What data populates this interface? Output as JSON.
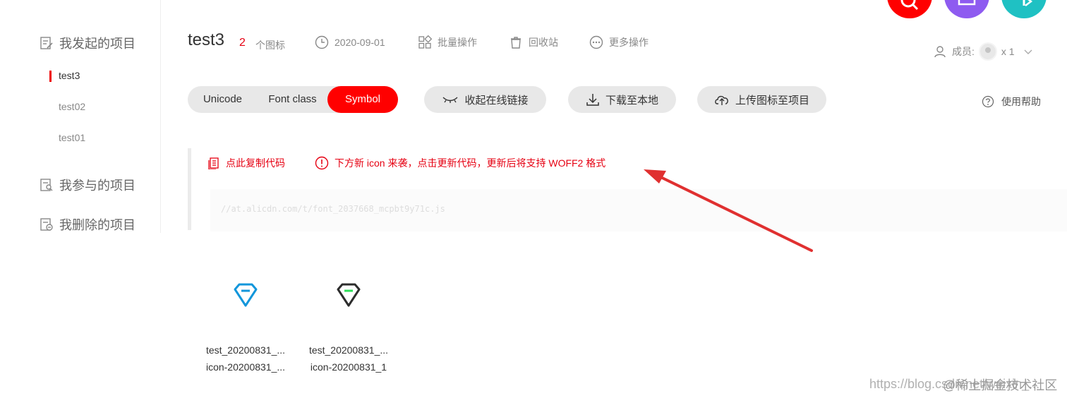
{
  "sidebar": {
    "group_mine": "我发起的项目",
    "items": [
      {
        "label": "test3",
        "active": true
      },
      {
        "label": "test02"
      },
      {
        "label": "test01"
      }
    ],
    "group_joined": "我参与的项目",
    "group_deleted": "我删除的项目"
  },
  "header": {
    "title": "test3",
    "count": "2",
    "count_unit": "个图标",
    "date": "2020-09-01",
    "batch": "批量操作",
    "recycle": "回收站",
    "more": "更多操作",
    "members_label": "成员:",
    "members_count": "x 1"
  },
  "toolbar": {
    "tabs": [
      "Unicode",
      "Font class",
      "Symbol"
    ],
    "active_tab": "Symbol",
    "collapse_link": "收起在线链接",
    "download": "下载至本地",
    "upload": "上传图标至项目",
    "help": "使用帮助"
  },
  "code": {
    "copy": "点此复制代码",
    "notice": "下方新 icon 来袭，点击更新代码，更新后将支持 WOFF2 格式",
    "url": "//at.alicdn.com/t/font_2037668_mcpbt9y71c.js"
  },
  "icons": [
    {
      "name": "test_20200831_...",
      "code": "icon-20200831_...",
      "color": "#1296db"
    },
    {
      "name": "test_20200831_...",
      "code": "icon-20200831_1",
      "color": "#2c2c2c"
    }
  ],
  "watermark": "https://blog.csdn.net/weixin_...",
  "watermark_brand": "@稀土掘金技术社区",
  "colors": {
    "accent": "#ff0000",
    "pill": "#e8e8e8",
    "purple": "#8e5bf0",
    "teal": "#1fc1c3"
  }
}
